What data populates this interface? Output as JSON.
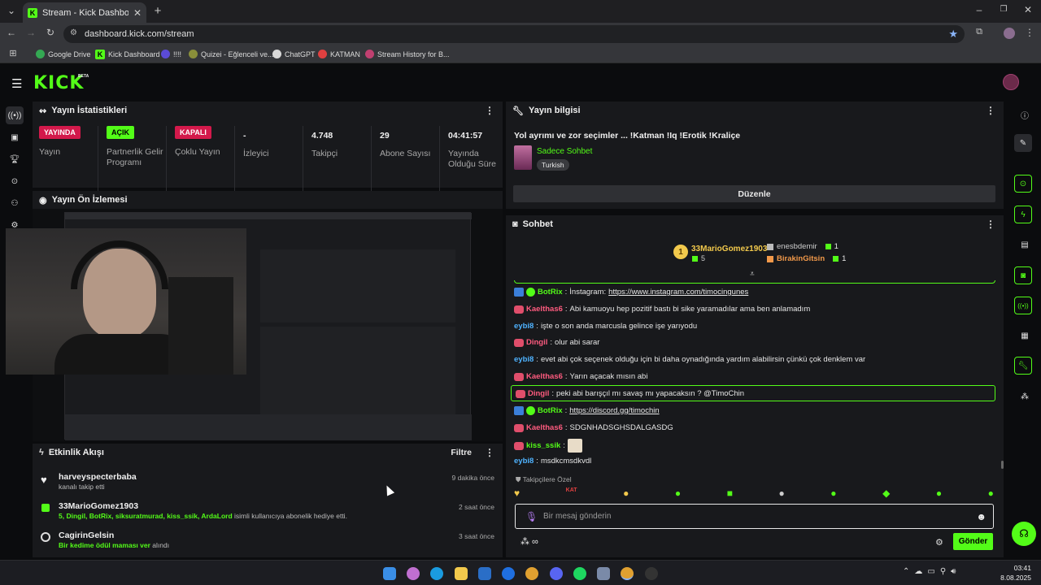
{
  "browser": {
    "tab_title": "Stream - Kick Dashboard",
    "url": "dashboard.kick.com/stream",
    "bookmarks": [
      {
        "label": "Google Drive",
        "color": "#34a853"
      },
      {
        "label": "Kick Dashboard",
        "color": "#53fc18"
      },
      {
        "label": "!!!!",
        "color": "#5b4bd6"
      },
      {
        "label": "Quizei - Eğlenceli ve...",
        "color": "#8a8f3a"
      },
      {
        "label": "ChatGPT",
        "color": "#d8d8d8"
      },
      {
        "label": "KATMAN",
        "color": "#e04040"
      },
      {
        "label": "Stream History for B...",
        "color": "#c04070"
      }
    ]
  },
  "app": {
    "logo": "KICK",
    "logo_badge": "BETA",
    "accent": "#53fc18"
  },
  "stats": {
    "title": "Yayın İstatistikleri",
    "items": [
      {
        "badge": "YAYINDA",
        "badge_color": "#d3194b",
        "label": "Yayın"
      },
      {
        "badge": "AÇIK",
        "badge_color": "#53fc18",
        "label": "Partnerlik Gelir Programı"
      },
      {
        "badge": "KAPALI",
        "badge_color": "#d3194b",
        "label": "Çoklu Yayın"
      },
      {
        "value": "-",
        "label": "İzleyici"
      },
      {
        "value": "4.748",
        "label": "Takipçi"
      },
      {
        "value": "29",
        "label": "Abone Sayısı"
      },
      {
        "value": "04:41:57",
        "label": "Yayında Olduğu Süre"
      }
    ]
  },
  "preview": {
    "title": "Yayın Ön İzlemesi"
  },
  "events": {
    "title": "Etkinlik Akışı",
    "filter_label": "Filtre",
    "items": [
      {
        "name": "harveyspecterbaba",
        "desc": "kanalı takip etti",
        "time": "9 dakika önce",
        "icon": "heart-icon"
      },
      {
        "name": "33MarioGomez1903",
        "desc_green": "5, Dingil, BotRix, siksuratmurad, kiss_ssik, ArdaLord",
        "desc": " isimli kullanıcıya abonelik hediye etti.",
        "time": "2 saat önce",
        "icon": "gift-icon"
      },
      {
        "name": "CagirinGelsin",
        "desc_green": "Bir kedime ödül maması ver",
        "desc": " alındı",
        "time": "3 saat önce",
        "icon": "points-icon"
      }
    ]
  },
  "stream_info": {
    "title": "Yayın bilgisi",
    "stream_title": "Yol ayrımı ve zor seçimler ... !Katman !Iq !Erotik !Kraliçe",
    "category": "Sadece Sohbet",
    "tag": "Turkish",
    "edit_button": "Düzenle"
  },
  "chat": {
    "title": "Sohbet",
    "leaderboard": {
      "first": {
        "rank": "1",
        "name": "33MarioGomez1903",
        "count": "5"
      },
      "others": [
        {
          "name": "enesbdemir",
          "count": "1",
          "color": "#d8d8d8"
        },
        {
          "name": "BirakinGitsin",
          "count": "1",
          "color": "#f2994a"
        }
      ]
    },
    "messages": [
      {
        "user": "BotRix",
        "color": "#53fc18",
        "prefix": "",
        "text": "İnstagram: ",
        "link": "https://www.instagram.com/timocingunes",
        "icons": [
          "bot",
          "verified"
        ]
      },
      {
        "user": "Kaelthas6",
        "color": "#ff5b7f",
        "text": "Abi kamuoyu hep pozitif bastı bi sike yaramadılar ama ben anlamadım",
        "icons": [
          "sub"
        ]
      },
      {
        "user": "eybi8",
        "color": "#4fb3ff",
        "text": "işte o son anda marcusla gelince işe yarıyodu",
        "icons": []
      },
      {
        "user": "Dingil",
        "color": "#ff5b7f",
        "text": "olur abi sarar",
        "icons": [
          "sub"
        ]
      },
      {
        "user": "eybi8",
        "color": "#4fb3ff",
        "text": "evet abi çok seçenek olduğu için bi daha oynadığında yardım alabilirsin çünkü çok denklem var",
        "icons": []
      },
      {
        "user": "Kaelthas6",
        "color": "#ff5b7f",
        "text": "Yarın açacak mısın abi",
        "icons": [
          "sub"
        ]
      },
      {
        "user": "Dingil",
        "color": "#ff5b7f",
        "text": "peki abi barışçıl mı savaş mı yapacaksın ? @TimoChin",
        "icons": [
          "sub"
        ],
        "highlight": true
      },
      {
        "user": "BotRix",
        "color": "#53fc18",
        "text": "",
        "link": "https://discord.gg/timochin",
        "icons": [
          "bot",
          "verified"
        ]
      },
      {
        "user": "Kaelthas6",
        "color": "#ff5b7f",
        "text": "SDGNHADSGHSDALGASDG",
        "icons": [
          "sub"
        ]
      },
      {
        "user": "kiss_ssik",
        "color": "#53fc18",
        "text": "",
        "emote": true,
        "icons": [
          "sub"
        ]
      },
      {
        "user": "eybi8",
        "color": "#4fb3ff",
        "text": "msdkcmsdkvdl",
        "icons": []
      }
    ],
    "followers_only_label": "Takipçilere Özel",
    "input_placeholder": "Bir mesaj gönderin",
    "send_button": "Gönder"
  },
  "taskbar": {
    "time": "03:41",
    "date": "8.08.2025"
  }
}
